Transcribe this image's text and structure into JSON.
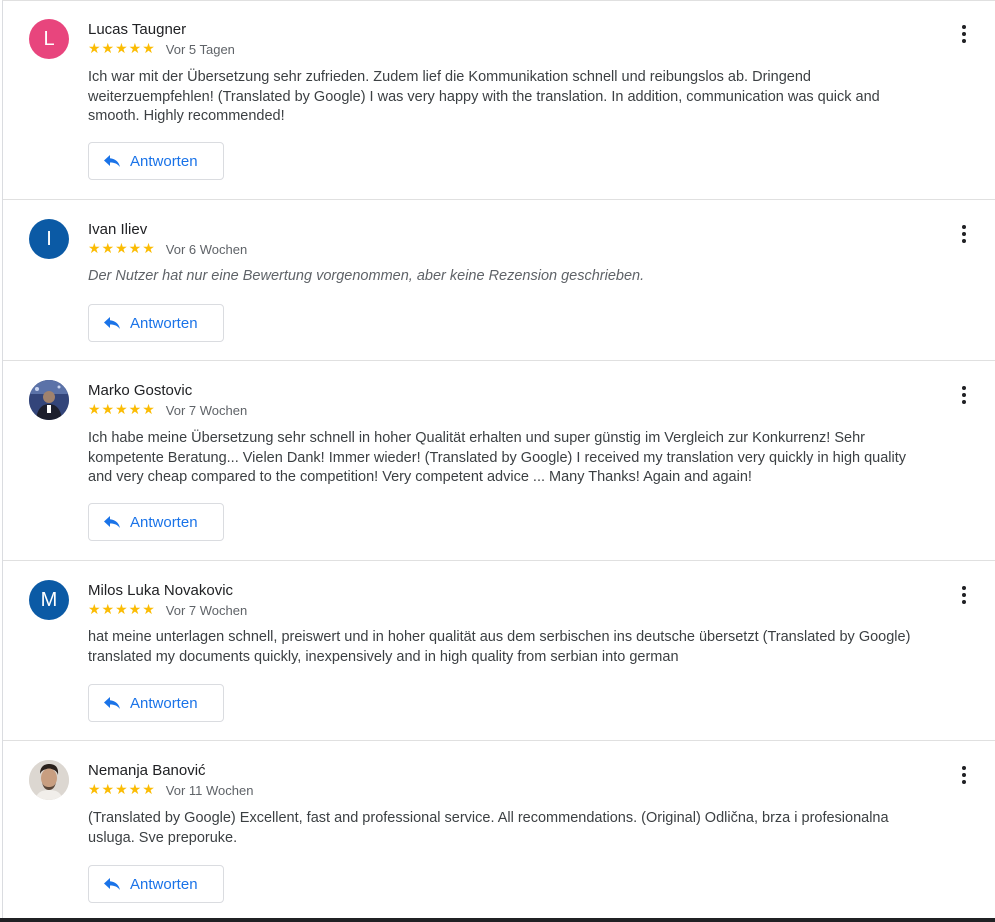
{
  "reviews": [
    {
      "initial": "L",
      "avatar_color": "#e8457d",
      "name": "Lucas Taugner",
      "stars": "★★★★★",
      "date": "Vor 5 Tagen",
      "text": "Ich war mit der Übersetzung sehr zufrieden. Zudem lief die Kommunikation schnell und reibungslos ab. Dringend weiterzuempfehlen! (Translated by Google) I was very happy with the translation. In addition, communication was quick and smooth. Highly recommended!",
      "reply_label": "Antworten"
    },
    {
      "initial": "I",
      "avatar_color": "#0b5aa5",
      "name": "Ivan Iliev",
      "stars": "★★★★★",
      "date": "Vor 6 Wochen",
      "text": "Der Nutzer hat nur eine Bewertung vorgenommen, aber keine Rezension geschrieben.",
      "reply_label": "Antworten"
    },
    {
      "initial": "",
      "avatar_color": "#2b3a6b",
      "name": "Marko Gostovic",
      "stars": "★★★★★",
      "date": "Vor 7 Wochen",
      "text": "Ich habe meine Übersetzung sehr schnell in hoher Qualität erhalten und super günstig im Vergleich zur Konkurrenz! Sehr kompetente Beratung... Vielen Dank! Immer wieder! (Translated by Google) I received my translation very quickly in high quality and very cheap compared to the competition! Very competent advice ... Many Thanks! Again and again!",
      "reply_label": "Antworten"
    },
    {
      "initial": "M",
      "avatar_color": "#0b5aa5",
      "name": "Milos Luka Novakovic",
      "stars": "★★★★★",
      "date": "Vor 7 Wochen",
      "text": "hat meine unterlagen schnell, preiswert und in hoher qualität aus dem serbischen ins deutsche übersetzt (Translated by Google) translated my documents quickly, inexpensively and in high quality from serbian into german",
      "reply_label": "Antworten"
    },
    {
      "initial": "",
      "avatar_color": "#d9d4ce",
      "name": "Nemanja Banović",
      "stars": "★★★★★",
      "date": "Vor 11 Wochen",
      "text": "(Translated by Google) Excellent, fast and professional service. All recommendations. (Original) Odlična, brza i profesionalna usluga. Sve preporuke.",
      "reply_label": "Antworten"
    }
  ]
}
